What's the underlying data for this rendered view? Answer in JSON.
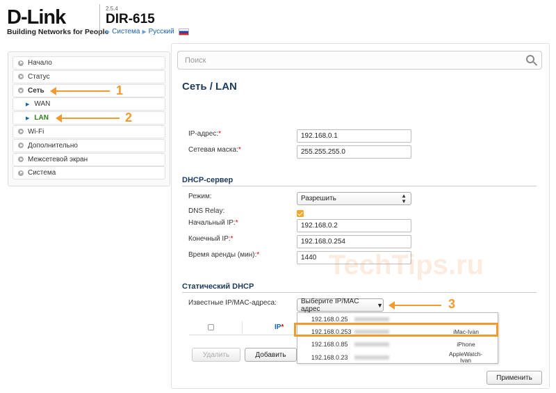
{
  "header": {
    "logo": "D-Link",
    "logo_tagline": "Building Networks for People",
    "firmware": "2.5.4",
    "model": "DIR-615",
    "breadcrumb_system": "Система",
    "breadcrumb_language": "Русский"
  },
  "sidebar": {
    "items": [
      {
        "label": "Начало"
      },
      {
        "label": "Статус"
      },
      {
        "label": "Сеть"
      },
      {
        "label": "WAN"
      },
      {
        "label": "LAN"
      },
      {
        "label": "Wi-Fi"
      },
      {
        "label": "Дополнительно"
      },
      {
        "label": "Межсетевой экран"
      },
      {
        "label": "Система"
      }
    ]
  },
  "annotations": {
    "n1": "1",
    "n2": "2",
    "n3": "3"
  },
  "search": {
    "placeholder": "Поиск"
  },
  "page": {
    "title": "Сеть /  LAN"
  },
  "lan": {
    "ip_label": "IP-адрес:",
    "ip_value": "192.168.0.1",
    "mask_label": "Сетевая маска:",
    "mask_value": "255.255.255.0"
  },
  "dhcp": {
    "section_title": "DHCP-сервер",
    "mode_label": "Режим:",
    "mode_value": "Разрешить",
    "relay_label": "DNS Relay:",
    "start_label": "Начальный IP:",
    "start_value": "192.168.0.2",
    "end_label": "Конечный IP:",
    "end_value": "192.168.0.254",
    "lease_label": "Время аренды (мин):",
    "lease_value": "1440"
  },
  "static_dhcp": {
    "section_title": "Статический DHCP",
    "known_label": "Известные IP/MAC-адреса:",
    "select_value": "Выберите IP/MAC адрес",
    "options": [
      {
        "ip": "192.168.0.25",
        "host": ""
      },
      {
        "ip": "192.168.0.253",
        "host": "iMac-Ivan"
      },
      {
        "ip": "192.168.0.85",
        "host": "iPhone"
      },
      {
        "ip": "192.168.0.23",
        "host": "AppleWatch-Ivan"
      }
    ],
    "column_ip": "IP"
  },
  "buttons": {
    "delete": "Удалить",
    "add": "Добавить",
    "apply": "Применить"
  },
  "watermark": "TechTips.ru",
  "colors": {
    "accent_orange": "#f29a2e",
    "title_blue": "#1b3a5c",
    "active_green": "#2f7d16"
  }
}
